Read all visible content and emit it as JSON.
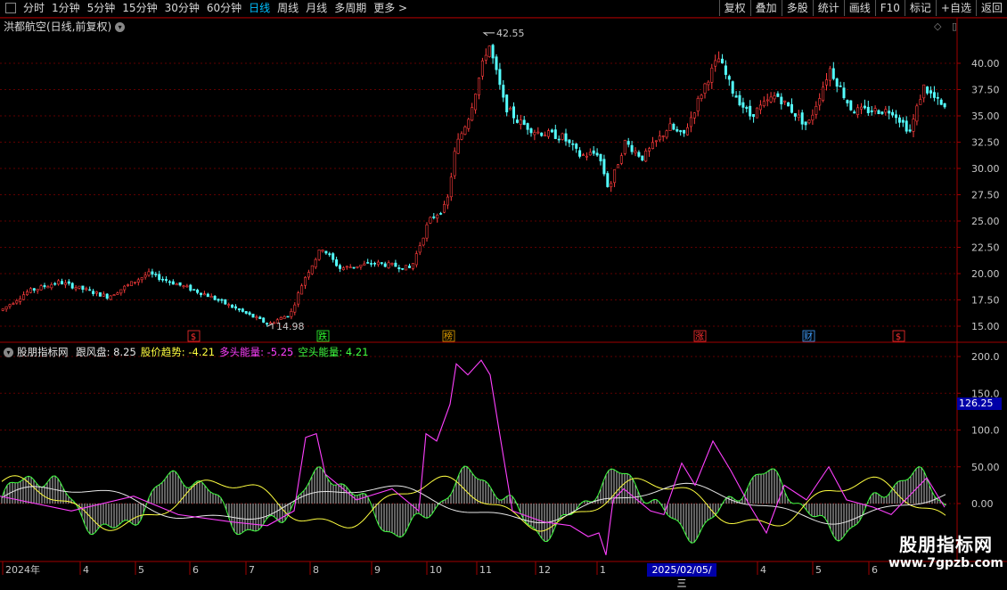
{
  "toolbar": {
    "periods": [
      "分时",
      "1分钟",
      "5分钟",
      "15分钟",
      "30分钟",
      "60分钟",
      "日线",
      "周线",
      "月线",
      "多周期",
      "更多 >"
    ],
    "active_period": "日线",
    "actions": [
      "复权",
      "叠加",
      "多股",
      "统计",
      "画线",
      "F10",
      "标记",
      "+自选",
      "返回"
    ]
  },
  "main_chart": {
    "title": "洪都航空(日线,前复权)",
    "high_label": "42.55",
    "low_label": "14.98",
    "y_ticks": [
      "40.00",
      "37.50",
      "35.00",
      "32.50",
      "30.00",
      "27.50",
      "25.00",
      "22.50",
      "20.00",
      "17.50",
      "15.00"
    ],
    "event_markers": [
      {
        "text": "$",
        "color": "#ff3030"
      },
      {
        "text": "跌",
        "color": "#30ff30"
      },
      {
        "text": "榜",
        "color": "#e0a000"
      },
      {
        "text": "涨",
        "color": "#ff3030"
      },
      {
        "text": "财",
        "color": "#40a0ff"
      },
      {
        "text": "$",
        "color": "#ff3030"
      }
    ]
  },
  "indicator": {
    "name": "股朋指标网",
    "items": [
      {
        "label": "跟风盘:",
        "value": "8.25",
        "color": "#e8e8e8"
      },
      {
        "label": "股价趋势:",
        "value": "-4.21",
        "color": "#ffff40"
      },
      {
        "label": "多头能量:",
        "value": "-5.25",
        "color": "#ff40ff"
      },
      {
        "label": "空头能量:",
        "value": "4.21",
        "color": "#40ff40"
      }
    ],
    "y_ticks": [
      "200.0",
      "150.0",
      "100.0",
      "50.00",
      "0.00"
    ],
    "current_value": "126.25"
  },
  "date_axis": {
    "labels": [
      "2024年",
      "4",
      "5",
      "6",
      "7",
      "8",
      "9",
      "10",
      "11",
      "12",
      "1",
      "2025/02/05/三",
      "4",
      "5",
      "6"
    ],
    "selected": "2025/02/05/三"
  },
  "watermark": {
    "line1": "股朋指标网",
    "line2": "www.7gpzb.com"
  },
  "colors": {
    "up": "#ff3c3c",
    "down": "#54ffff",
    "grid": "#600000",
    "axis": "#a00000"
  }
}
